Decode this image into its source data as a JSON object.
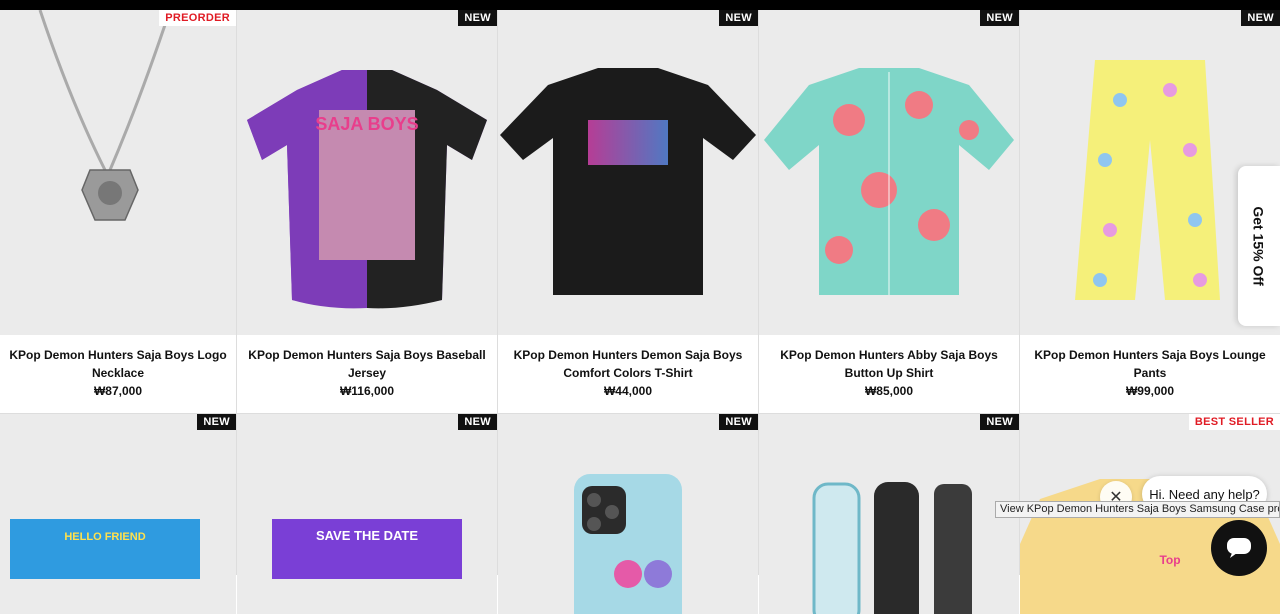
{
  "products_row1": [
    {
      "badge": "PREORDER",
      "badge_style": "light",
      "name": "KPop Demon Hunters Saja Boys Logo Necklace",
      "price": "₩87,000"
    },
    {
      "badge": "NEW",
      "badge_style": "dark",
      "name": "KPop Demon Hunters Saja Boys Baseball Jersey",
      "price": "₩116,000"
    },
    {
      "badge": "NEW",
      "badge_style": "dark",
      "name": "KPop Demon Hunters Demon Saja Boys Comfort Colors T-Shirt",
      "price": "₩44,000"
    },
    {
      "badge": "NEW",
      "badge_style": "dark",
      "name": "KPop Demon Hunters Abby Saja Boys Button Up Shirt",
      "price": "₩85,000"
    },
    {
      "badge": "NEW",
      "badge_style": "dark",
      "name": "KPop Demon Hunters Saja Boys Lounge Pants",
      "price": "₩99,000"
    }
  ],
  "products_row2": [
    {
      "badge": "NEW",
      "badge_style": "dark",
      "image_text": "HELLO FRIEND"
    },
    {
      "badge": "NEW",
      "badge_style": "dark",
      "image_text": "SAVE THE DATE"
    },
    {
      "badge": "NEW",
      "badge_style": "dark",
      "image_text": ""
    },
    {
      "badge": "NEW",
      "badge_style": "dark",
      "image_text": ""
    },
    {
      "badge": "BEST SELLER",
      "badge_style": "light",
      "image_text": "Top"
    }
  ],
  "jersey_logo_text": "SAJA BOYS",
  "side_tab": {
    "label": "Get 15% Off"
  },
  "chat": {
    "greeting": "Hi. Need any help?",
    "close_label": "✕"
  },
  "tooltip": {
    "text": "View KPop Demon Hunters Saja Boys Samsung Case product"
  },
  "colors": {
    "badge_red": "#e01b24",
    "badge_dark": "#111111",
    "image_bg": "#ebebeb"
  }
}
